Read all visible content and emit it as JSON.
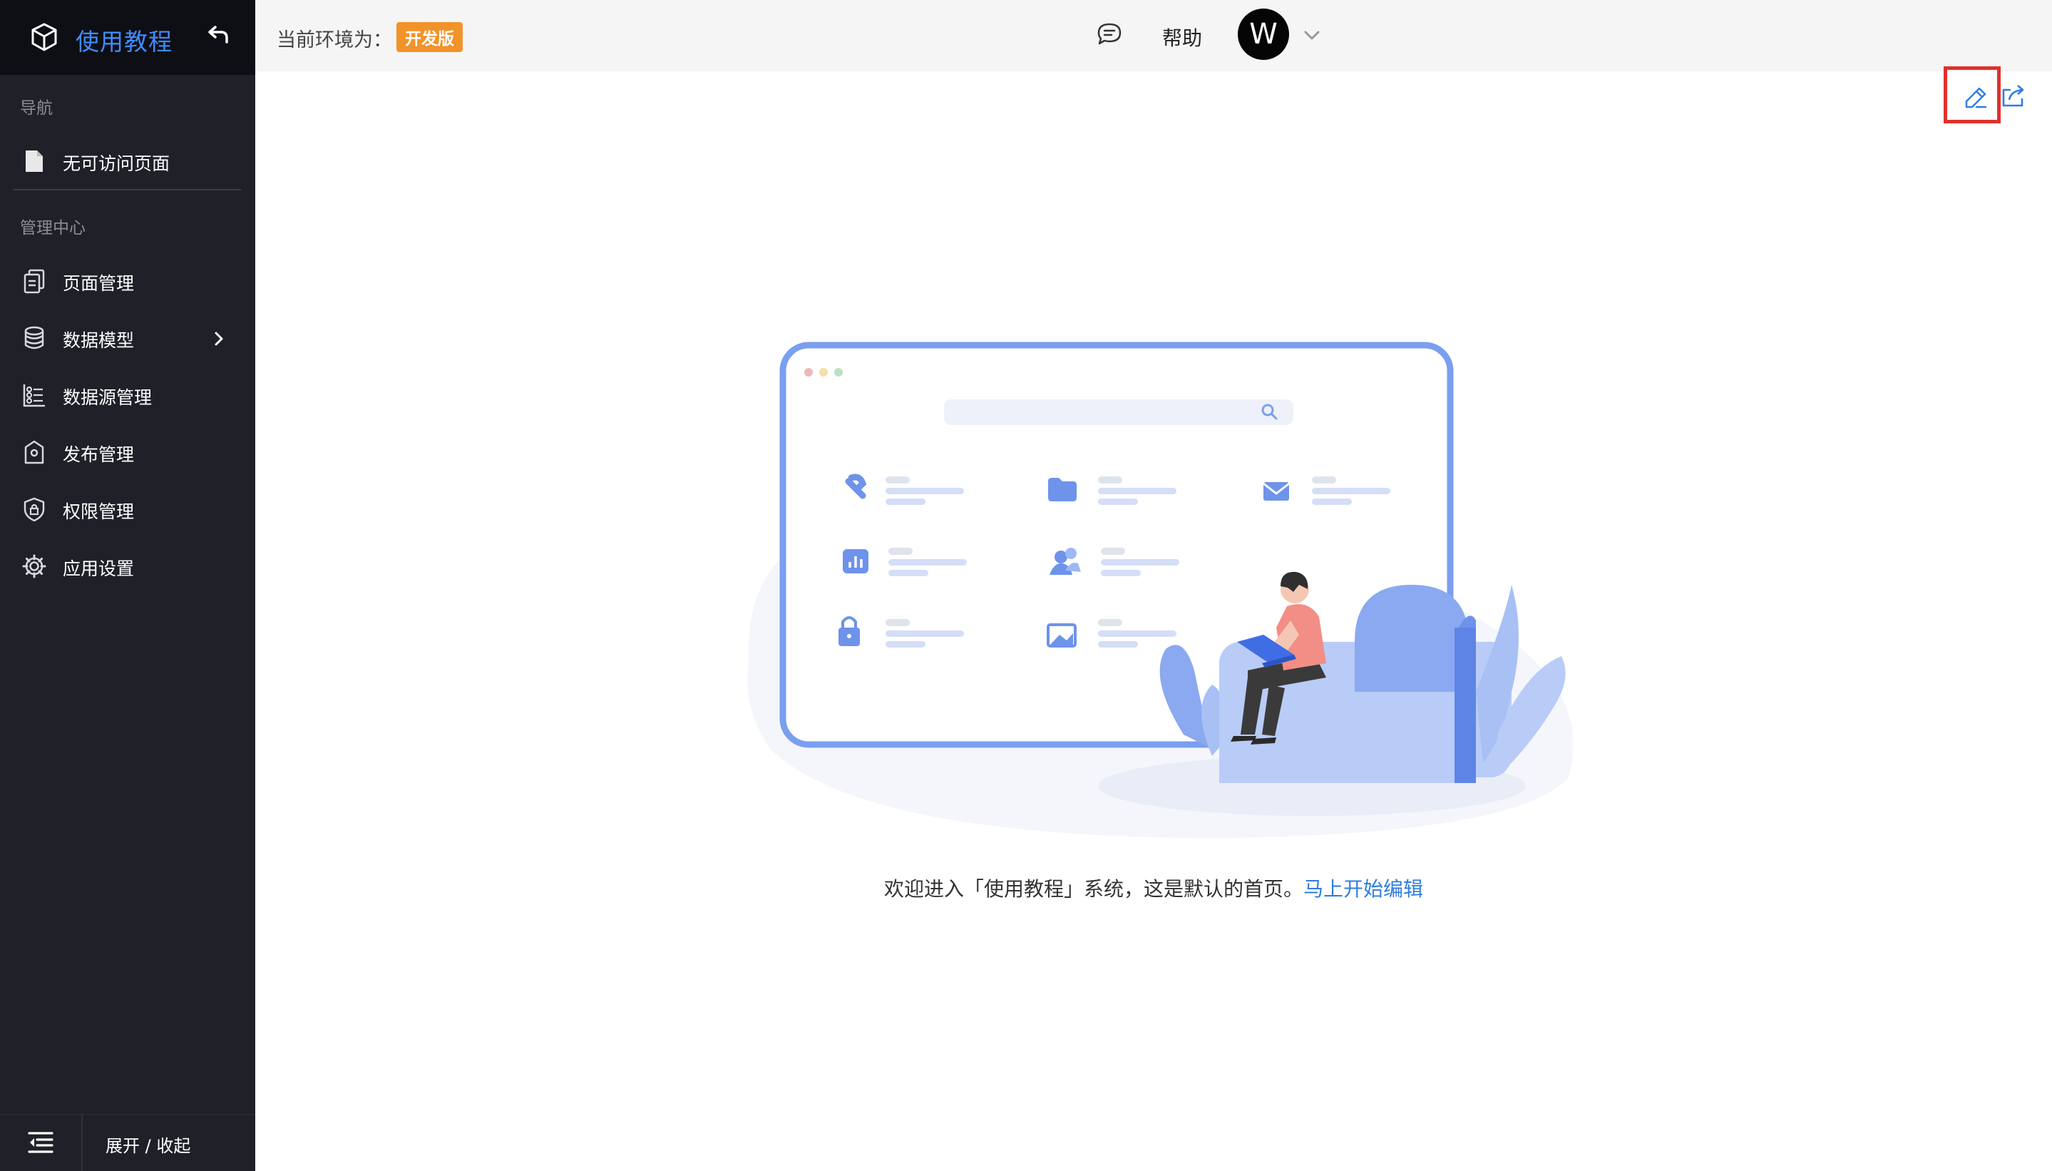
{
  "sidebar": {
    "app_name": "使用教程",
    "sections": [
      {
        "label": "导航"
      },
      {
        "label": "管理中心"
      }
    ],
    "nav_items": [
      {
        "label": "无可访问页面",
        "icon": "document-icon"
      }
    ],
    "manage_items": [
      {
        "label": "页面管理",
        "icon": "pages-icon"
      },
      {
        "label": "数据模型",
        "icon": "database-icon",
        "has_submenu": true
      },
      {
        "label": "数据源管理",
        "icon": "datasource-icon"
      },
      {
        "label": "发布管理",
        "icon": "publish-icon"
      },
      {
        "label": "权限管理",
        "icon": "shield-lock-icon"
      },
      {
        "label": "应用设置",
        "icon": "gear-icon"
      }
    ],
    "footer": {
      "collapse_label": "展开 / 收起"
    }
  },
  "topbar": {
    "env_label": "当前环境为：",
    "env_badge": "开发版",
    "help_label": "帮助",
    "avatar_initial": "W"
  },
  "main": {
    "welcome_text": "欢迎进入「使用教程」系统，这是默认的首页。",
    "welcome_link": "马上开始编辑"
  },
  "colors": {
    "sidebar_bg": "#1f2028",
    "accent": "#3f8cff",
    "badge": "#f2932a",
    "highlight_box": "#e0312d",
    "link": "#2f7de1"
  }
}
